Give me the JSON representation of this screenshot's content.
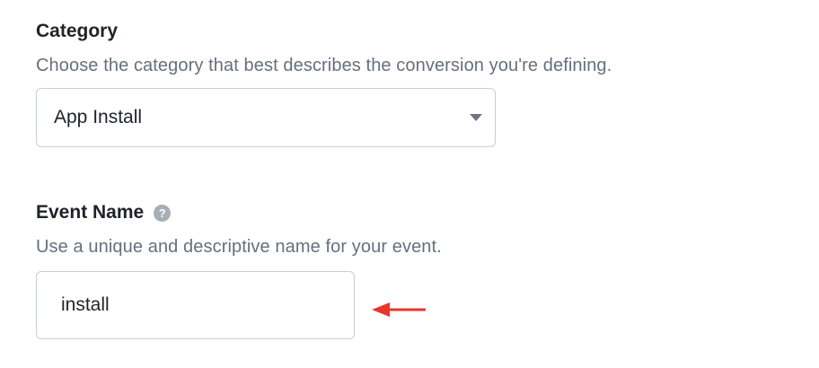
{
  "category": {
    "label": "Category",
    "description": "Choose the category that best describes the conversion you're defining.",
    "selected": "App Install"
  },
  "event_name": {
    "label": "Event Name",
    "help_icon": "?",
    "description": "Use a unique and descriptive name for your event.",
    "value": "install"
  },
  "colors": {
    "annotation_arrow": "#e8382b",
    "description_text": "#65707d",
    "border": "#c9ced4"
  },
  "icons": {
    "select_caret": "chevron-down-icon",
    "help": "question-circle-icon",
    "annotation": "arrow-left-icon"
  }
}
